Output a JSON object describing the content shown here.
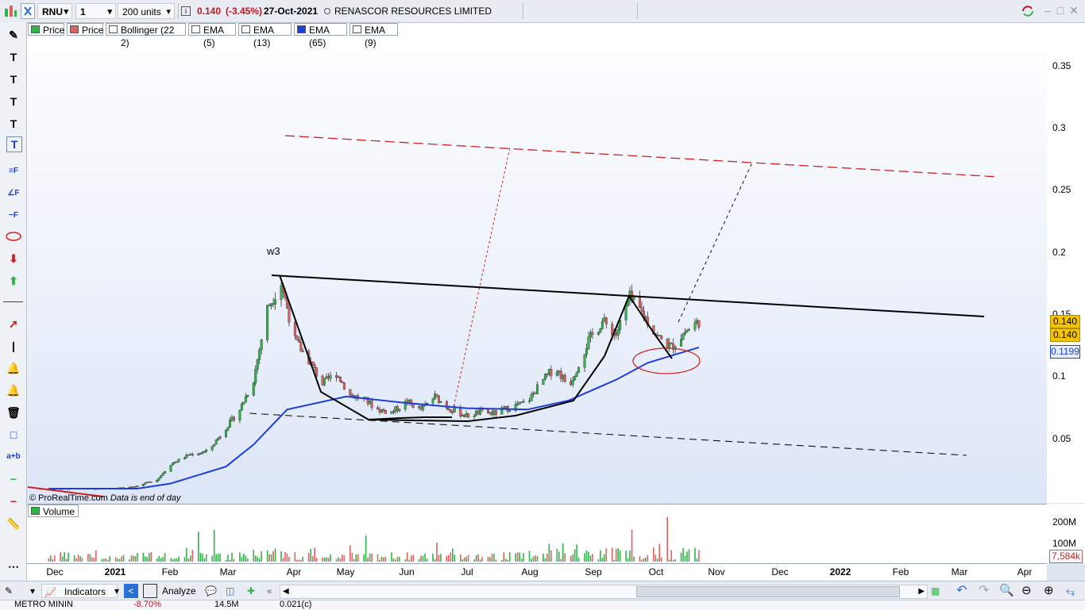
{
  "toolbar": {
    "symbol": "RNU",
    "timeframe": "1 day",
    "units": "200 units",
    "last_price": "0.140",
    "change": "(-3.45%)",
    "date": "27-Oct-2021",
    "company": "RENASCOR RESOURCES LIMITED"
  },
  "legend": [
    {
      "label": "Price",
      "color": "#2fb44a"
    },
    {
      "label": "Price",
      "color": "#e06060"
    },
    {
      "label": "Bollinger (22 2)",
      "color": "#ffffff"
    },
    {
      "label": "EMA (5)",
      "color": "#ffffff"
    },
    {
      "label": "EMA (13)",
      "color": "#ffffff"
    },
    {
      "label": "EMA (65)",
      "color": "#1b3fd8"
    },
    {
      "label": "EMA (9)",
      "color": "#ffffff"
    }
  ],
  "annotations": {
    "wave_label": "w3",
    "watermark": "© ProRealTime.com",
    "watermark_note": "Data is end of day"
  },
  "price_axis": {
    "ticks": [
      "0.35",
      "0.3",
      "0.25",
      "0.2",
      "0.15",
      "0.1",
      "0.05"
    ],
    "tag_close": "0.140",
    "tag_open": "0.140",
    "tag_ema": "0.1199"
  },
  "volume": {
    "label": "Volume",
    "ticks": [
      "200M",
      "100M"
    ],
    "last": "7,584k"
  },
  "time_axis": {
    "labels": [
      {
        "t": "Dec",
        "bold": false
      },
      {
        "t": "2021",
        "bold": true
      },
      {
        "t": "Feb",
        "bold": false
      },
      {
        "t": "Mar",
        "bold": false
      },
      {
        "t": "Apr",
        "bold": false
      },
      {
        "t": "May",
        "bold": false
      },
      {
        "t": "Jun",
        "bold": false
      },
      {
        "t": "Jul",
        "bold": false
      },
      {
        "t": "Aug",
        "bold": false
      },
      {
        "t": "Sep",
        "bold": false
      },
      {
        "t": "Oct",
        "bold": false
      },
      {
        "t": "Nov",
        "bold": false
      },
      {
        "t": "Dec",
        "bold": false
      },
      {
        "t": "2022",
        "bold": true
      },
      {
        "t": "Feb",
        "bold": false
      },
      {
        "t": "Mar",
        "bold": false
      },
      {
        "t": "Apr",
        "bold": false
      }
    ]
  },
  "bottombar": {
    "indicators": "Indicators",
    "analyze": "Analyze"
  },
  "strip": {
    "name": "METRO MININ",
    "change": "-8.70%",
    "volume": "14.5M",
    "price": "0.021(c)"
  },
  "colors": {
    "bull": "#2fb44a",
    "bear": "#e06060",
    "ema": "#1b3fd8",
    "red_channel": "#e03030"
  },
  "chart_data": {
    "type": "candlestick",
    "y_range": [
      0.0,
      0.37
    ],
    "price_series": [
      [
        "2020-12-01",
        0.011
      ],
      [
        "2021-01-01",
        0.011
      ],
      [
        "2021-01-15",
        0.013
      ],
      [
        "2021-01-25",
        0.018
      ],
      [
        "2021-02-01",
        0.03
      ],
      [
        "2021-02-10",
        0.037
      ],
      [
        "2021-02-20",
        0.04
      ],
      [
        "2021-03-01",
        0.058
      ],
      [
        "2021-03-08",
        0.072
      ],
      [
        "2021-03-15",
        0.095
      ],
      [
        "2021-03-22",
        0.15
      ],
      [
        "2021-03-29",
        0.17
      ],
      [
        "2021-04-05",
        0.125
      ],
      [
        "2021-04-12",
        0.11
      ],
      [
        "2021-04-19",
        0.092
      ],
      [
        "2021-04-26",
        0.1
      ],
      [
        "2021-05-03",
        0.083
      ],
      [
        "2021-05-10",
        0.08
      ],
      [
        "2021-05-17",
        0.072
      ],
      [
        "2021-05-24",
        0.07
      ],
      [
        "2021-06-01",
        0.078
      ],
      [
        "2021-06-08",
        0.072
      ],
      [
        "2021-06-15",
        0.082
      ],
      [
        "2021-06-22",
        0.073
      ],
      [
        "2021-07-01",
        0.067
      ],
      [
        "2021-07-08",
        0.07
      ],
      [
        "2021-07-15",
        0.069
      ],
      [
        "2021-07-22",
        0.073
      ],
      [
        "2021-08-01",
        0.078
      ],
      [
        "2021-08-08",
        0.093
      ],
      [
        "2021-08-15",
        0.105
      ],
      [
        "2021-08-22",
        0.09
      ],
      [
        "2021-09-01",
        0.125
      ],
      [
        "2021-09-08",
        0.14
      ],
      [
        "2021-09-15",
        0.13
      ],
      [
        "2021-09-22",
        0.158
      ],
      [
        "2021-09-29",
        0.145
      ],
      [
        "2021-10-06",
        0.128
      ],
      [
        "2021-10-13",
        0.12
      ],
      [
        "2021-10-20",
        0.132
      ],
      [
        "2021-10-27",
        0.14
      ]
    ],
    "ema65": [
      [
        "2020-12-01",
        0.011
      ],
      [
        "2021-01-15",
        0.011
      ],
      [
        "2021-02-01",
        0.015
      ],
      [
        "2021-03-01",
        0.028
      ],
      [
        "2021-03-15",
        0.045
      ],
      [
        "2021-04-01",
        0.072
      ],
      [
        "2021-05-01",
        0.082
      ],
      [
        "2021-06-01",
        0.077
      ],
      [
        "2021-07-01",
        0.073
      ],
      [
        "2021-08-01",
        0.072
      ],
      [
        "2021-08-22",
        0.079
      ],
      [
        "2021-09-15",
        0.095
      ],
      [
        "2021-10-01",
        0.108
      ],
      [
        "2021-10-27",
        0.1199
      ]
    ]
  }
}
